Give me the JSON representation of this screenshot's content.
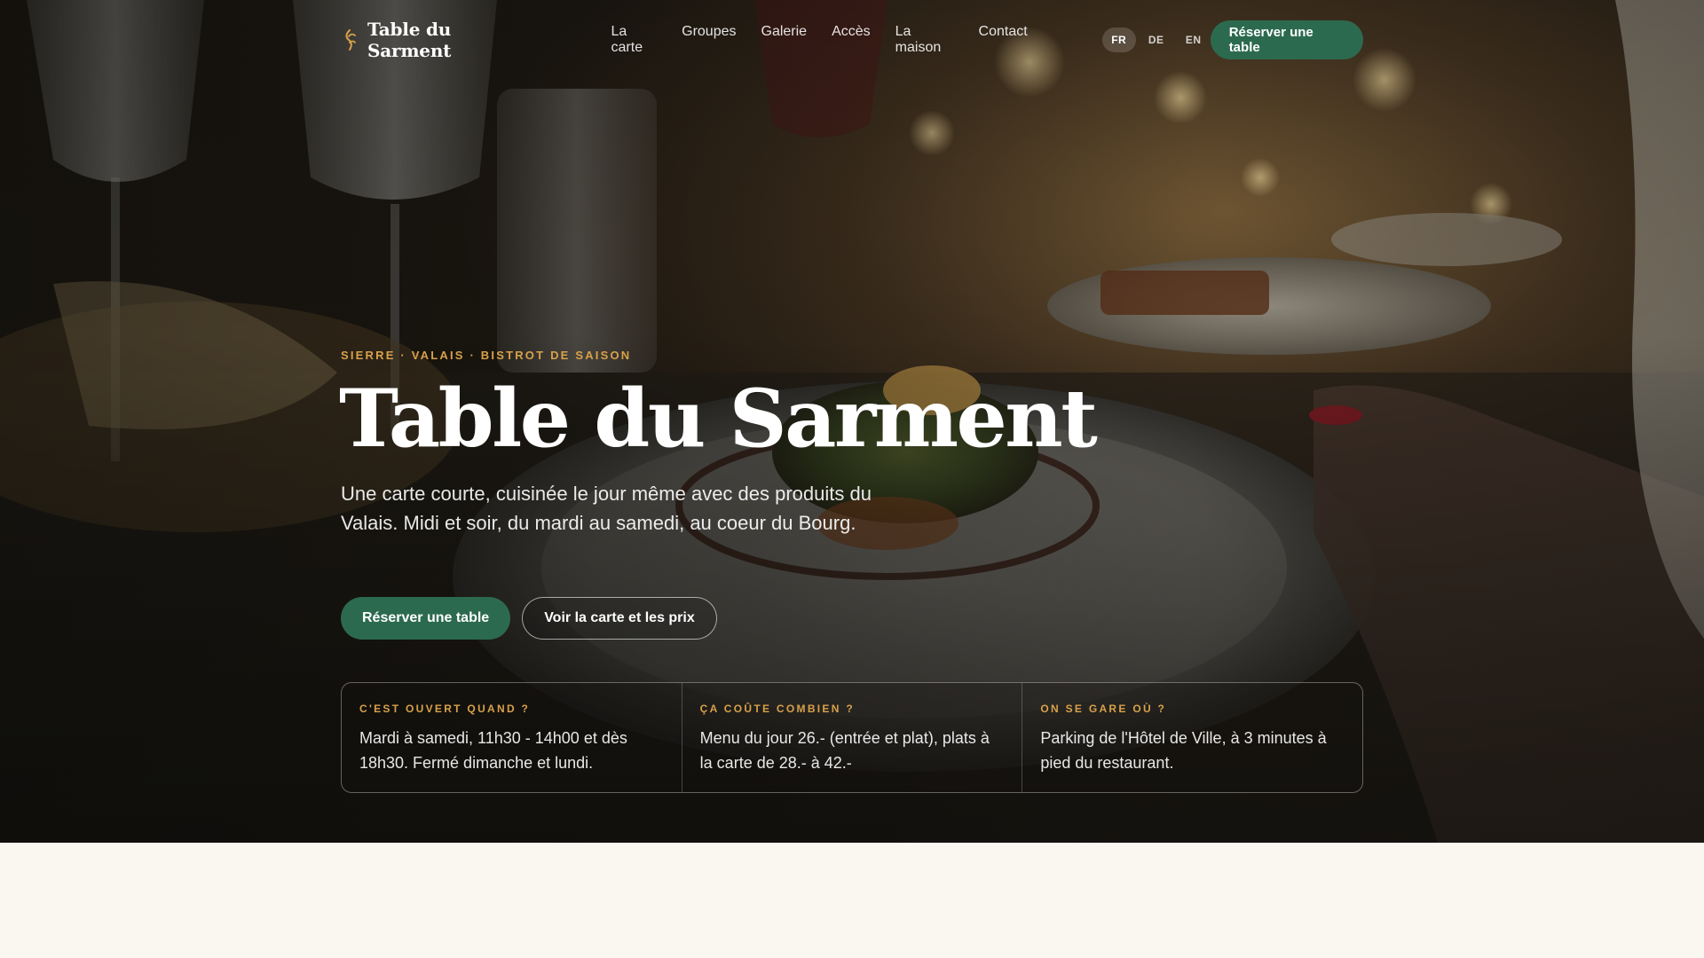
{
  "brand": {
    "name": "Table du Sarment",
    "icon": "vine-leaf-icon"
  },
  "nav": {
    "items": [
      {
        "label": "La carte"
      },
      {
        "label": "Groupes"
      },
      {
        "label": "Galerie"
      },
      {
        "label": "Accès"
      },
      {
        "label": "La maison"
      },
      {
        "label": "Contact"
      }
    ]
  },
  "languages": {
    "items": [
      {
        "label": "FR",
        "active": true
      },
      {
        "label": "DE",
        "active": false
      },
      {
        "label": "EN",
        "active": false
      }
    ]
  },
  "header": {
    "cta_label": "Réserver une table"
  },
  "hero": {
    "eyebrow": "SIERRE · VALAIS · BISTROT DE SAISON",
    "title": "Table du Sarment",
    "subtitle": "Une carte courte, cuisinée le jour même avec des produits du Valais. Midi et soir, du mardi au samedi, au coeur du Bourg.",
    "primary_cta": "Réserver une table",
    "secondary_cta": "Voir la carte et les prix"
  },
  "info": {
    "columns": [
      {
        "label": "C'EST OUVERT QUAND ?",
        "text": "Mardi à samedi, 11h30 - 14h00 et dès 18h30. Fermé dimanche et lundi."
      },
      {
        "label": "ÇA COÛTE COMBIEN ?",
        "text": "Menu du jour 26.- (entrée et plat), plats à la carte de 28.- à 42.-"
      },
      {
        "label": "ON SE GARE OÙ ?",
        "text": "Parking de l'Hôtel de Ville, à 3 minutes à pied du restaurant."
      }
    ]
  },
  "colors": {
    "accent_green": "#2c6a4f",
    "eyebrow_gold": "#d8a14a",
    "page_bg": "#faf7f1"
  }
}
